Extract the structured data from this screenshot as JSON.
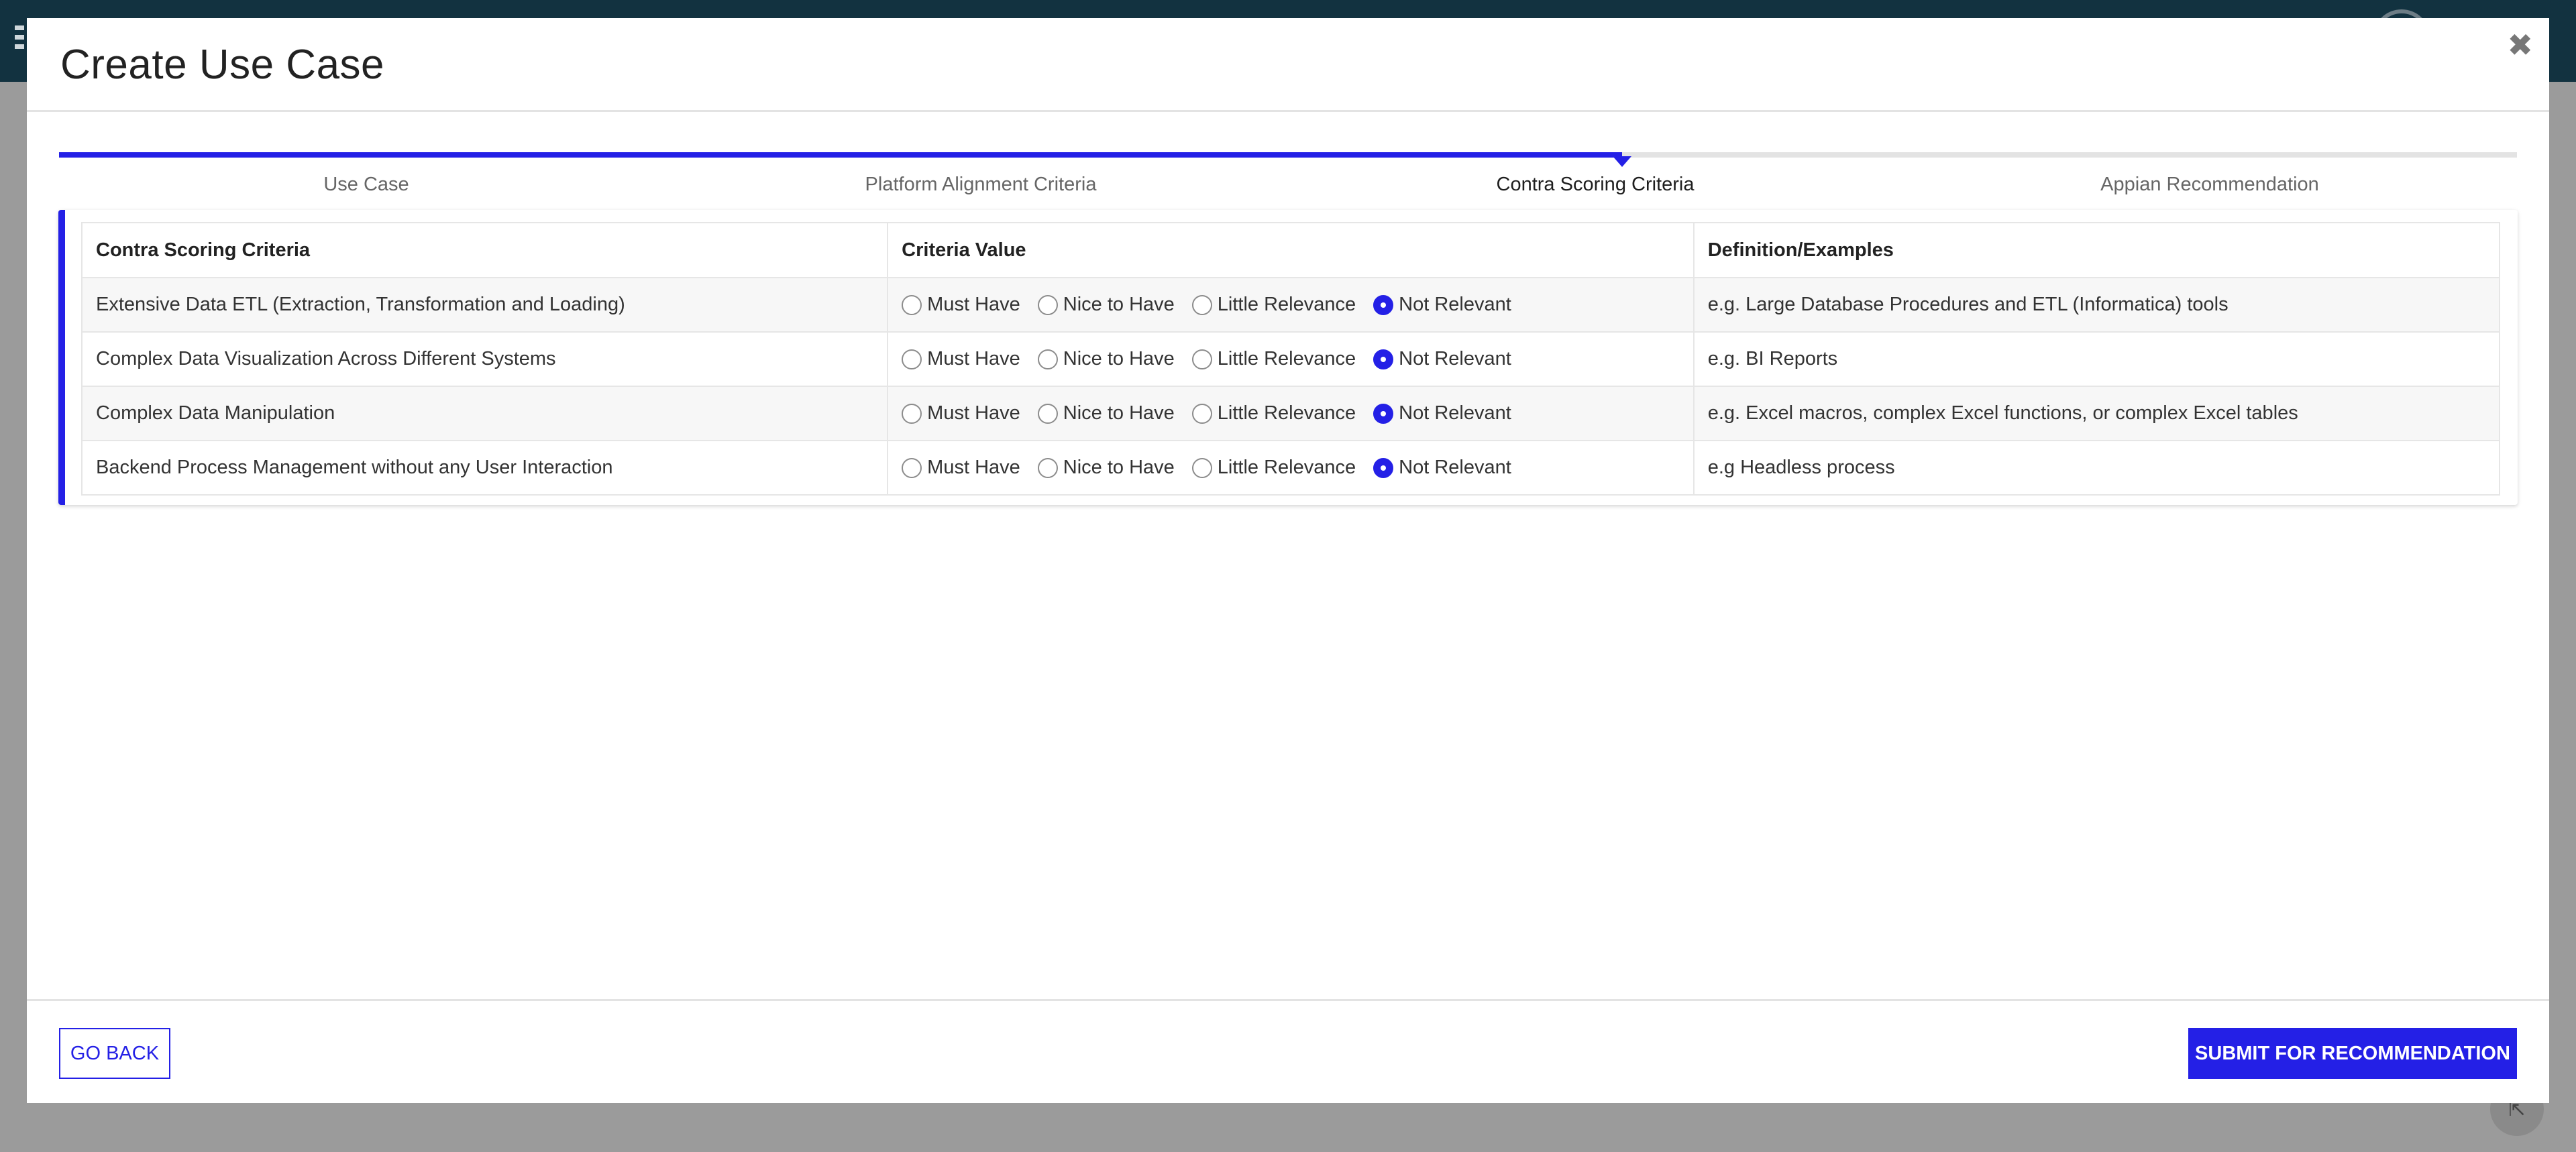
{
  "modal": {
    "title": "Create Use Case",
    "close_icon": "close-icon"
  },
  "stepper": {
    "steps": [
      {
        "label": "Use Case",
        "state": "complete"
      },
      {
        "label": "Platform Alignment Criteria",
        "state": "complete"
      },
      {
        "label": "Contra Scoring Criteria",
        "state": "active"
      },
      {
        "label": "Appian Recommendation",
        "state": "pending"
      }
    ],
    "active_index": 2
  },
  "table": {
    "headers": [
      "Contra Scoring Criteria",
      "Criteria Value",
      "Definition/Examples"
    ],
    "options": [
      "Must Have",
      "Nice to Have",
      "Little Relevance",
      "Not Relevant"
    ],
    "rows": [
      {
        "criteria": "Extensive Data ETL (Extraction, Transformation and Loading)",
        "selected": "Not Relevant",
        "definition": "e.g. Large Database Procedures and ETL (Informatica) tools"
      },
      {
        "criteria": "Complex Data Visualization Across Different Systems",
        "selected": "Not Relevant",
        "definition": "e.g. BI Reports"
      },
      {
        "criteria": "Complex Data Manipulation",
        "selected": "Not Relevant",
        "definition": "e.g. Excel macros, complex Excel functions, or complex Excel tables"
      },
      {
        "criteria": "Backend Process Management without any User Interaction",
        "selected": "Not Relevant",
        "definition": "e.g Headless process"
      }
    ]
  },
  "footer": {
    "back_label": "GO BACK",
    "submit_label": "SUBMIT FOR RECOMMENDATION"
  },
  "colors": {
    "accent": "#2420e6",
    "topbar": "#123240",
    "overlay": "#9b9b9b"
  }
}
